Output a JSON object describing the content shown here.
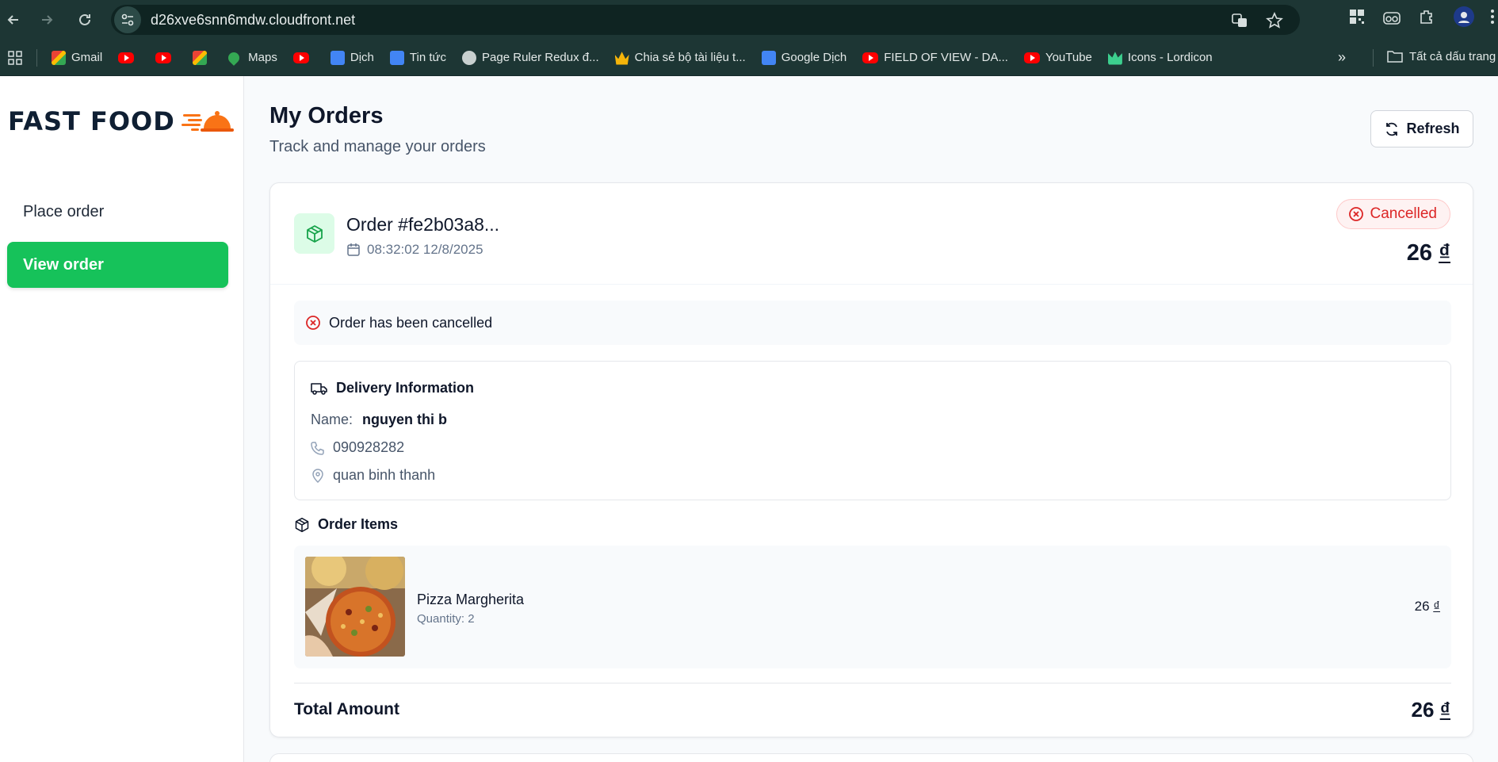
{
  "browser": {
    "url": "d26xve6snn6mdw.cloudfront.net",
    "bookmarks": [
      {
        "label": "Gmail",
        "icon": "gmail-icon"
      },
      {
        "label": "",
        "icon": "youtube-icon"
      },
      {
        "label": "",
        "icon": "youtube-icon"
      },
      {
        "label": "",
        "icon": "gmail-icon"
      },
      {
        "label": "Maps",
        "icon": "maps-icon"
      },
      {
        "label": "",
        "icon": "youtube-icon"
      },
      {
        "label": "Dịch",
        "icon": "google-translate-icon"
      },
      {
        "label": "Tin tức",
        "icon": "google-news-icon"
      },
      {
        "label": "Page Ruler Redux đ...",
        "icon": "globe-icon"
      },
      {
        "label": "Chia sẻ bộ tài liệu t...",
        "icon": "crown-icon"
      },
      {
        "label": "Google Dịch",
        "icon": "google-translate-icon"
      },
      {
        "label": "FIELD OF VIEW - DA...",
        "icon": "youtube-icon"
      },
      {
        "label": "YouTube",
        "icon": "youtube-icon"
      },
      {
        "label": "Icons - Lordicon",
        "icon": "lordicon-icon"
      }
    ],
    "more_label": "»",
    "all_bookmarks_label": "Tất cả dấu trang"
  },
  "brand": {
    "name": "FAST FOOD",
    "accent": "#16c25a",
    "logo_color": "#f97316"
  },
  "sidebar": {
    "items": [
      {
        "label": "Place order",
        "active": false
      },
      {
        "label": "View order",
        "active": true
      }
    ]
  },
  "header": {
    "title": "My Orders",
    "subtitle": "Track and manage your orders",
    "refresh_label": "Refresh"
  },
  "order": {
    "id": "Order #fe2b03a8...",
    "datetime": "08:32:02 12/8/2025",
    "status": "Cancelled",
    "amount": "26",
    "currency": "₫",
    "cancel_message": "Order has been cancelled",
    "delivery": {
      "title": "Delivery Information",
      "name_label": "Name:",
      "name": "nguyen thi b",
      "phone": "090928282",
      "address": "quan binh thanh"
    },
    "items_title": "Order Items",
    "items": [
      {
        "name": "Pizza Margherita",
        "quantity": "Quantity: 2",
        "price": "26",
        "currency": "₫"
      }
    ],
    "total_label": "Total Amount",
    "total_value": "26",
    "total_currency": "₫"
  },
  "colors": {
    "status_cancelled": "#dc2626",
    "status_bg": "#fef2f2",
    "primary": "#16c25a"
  }
}
